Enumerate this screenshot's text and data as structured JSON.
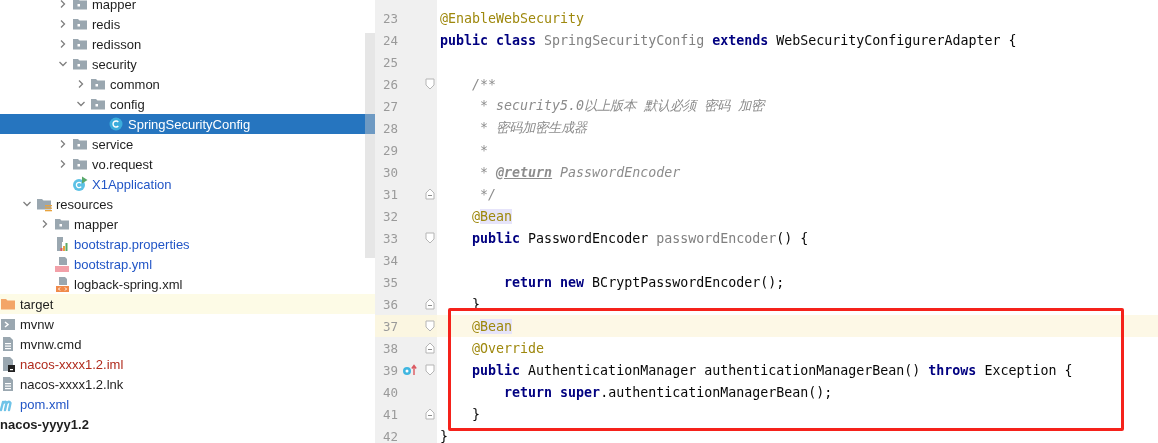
{
  "project_tree": {
    "items": [
      {
        "children": [
          {
            "children": [
              {
                "children": [
                  {
                    "label": "mapper",
                    "kind": "folder",
                    "expanded": false,
                    "selected": false,
                    "highlighted": false
                  },
                  {
                    "label": "redis",
                    "kind": "folder",
                    "expanded": false,
                    "selected": false,
                    "highlighted": false
                  },
                  {
                    "label": "redisson",
                    "kind": "folder",
                    "expanded": false,
                    "selected": false,
                    "highlighted": false
                  },
                  {
                    "label": "security",
                    "kind": "folder",
                    "expanded": true,
                    "selected": false,
                    "highlighted": false,
                    "children": [
                      {
                        "label": "common",
                        "kind": "folder",
                        "expanded": false,
                        "selected": false,
                        "highlighted": false
                      },
                      {
                        "label": "config",
                        "kind": "folder",
                        "expanded": true,
                        "selected": false,
                        "highlighted": false,
                        "children": [
                          {
                            "label": "SpringSecurityConfig",
                            "kind": "class",
                            "selected": true,
                            "highlighted": false
                          }
                        ]
                      }
                    ]
                  },
                  {
                    "label": "service",
                    "kind": "folder",
                    "expanded": false,
                    "selected": false,
                    "highlighted": false
                  },
                  {
                    "label": "vo.request",
                    "kind": "folder",
                    "expanded": false,
                    "selected": false,
                    "highlighted": false
                  },
                  {
                    "label": "X1Application",
                    "kind": "main-class",
                    "selected": false,
                    "highlighted": false,
                    "color": "#2155c6"
                  }
                ]
              }
            ]
          },
          {
            "label": "resources",
            "kind": "resources-folder",
            "expanded": true,
            "selected": false,
            "highlighted": false,
            "children": [
              {
                "label": "mapper",
                "kind": "folder",
                "expanded": false,
                "selected": false,
                "highlighted": false
              },
              {
                "label": "bootstrap.properties",
                "kind": "properties",
                "selected": false,
                "highlighted": false,
                "color": "#2155c6"
              },
              {
                "label": "bootstrap.yml",
                "kind": "yml",
                "selected": false,
                "highlighted": false,
                "color": "#2155c6"
              },
              {
                "label": "logback-spring.xml",
                "kind": "xml",
                "selected": false,
                "highlighted": false
              }
            ]
          }
        ]
      },
      {
        "label": "target",
        "kind": "excluded-folder",
        "selected": false,
        "highlighted": true
      },
      {
        "label": "mvnw",
        "kind": "script",
        "selected": false,
        "highlighted": false
      },
      {
        "label": "mvnw.cmd",
        "kind": "text-file",
        "selected": false,
        "highlighted": false
      },
      {
        "label": "nacos-xxxx1.2.iml",
        "kind": "iml",
        "selected": false,
        "highlighted": false,
        "color": "#b02a1c"
      },
      {
        "label": "nacos-xxxx1.2.lnk",
        "kind": "text-file",
        "selected": false,
        "highlighted": false
      },
      {
        "label": "pom.xml",
        "kind": "maven",
        "selected": false,
        "highlighted": false,
        "color": "#2155c6"
      },
      {
        "label": "nacos-yyyy1.2",
        "kind": "module",
        "selected": false,
        "highlighted": false
      }
    ]
  },
  "editor": {
    "lines": [
      {
        "number": "23",
        "current": false,
        "boxed": false,
        "fold_start": false,
        "fold_end": false,
        "overrides": false,
        "tokens": [
          {
            "kind": "annotation",
            "text": "@EnableWebSecurity"
          }
        ]
      },
      {
        "number": "24",
        "current": false,
        "boxed": false,
        "fold_start": false,
        "fold_end": false,
        "overrides": false,
        "tokens": [
          {
            "kind": "keyword",
            "text": "public"
          },
          {
            "kind": "keyword",
            "text": " class"
          },
          {
            "kind": "unused",
            "text": " SpringSecurityConfig"
          },
          {
            "kind": "keyword",
            "text": " extends"
          },
          {
            "kind": "plain",
            "text": " WebSecurityConfigurerAdapter {"
          }
        ]
      },
      {
        "number": "25",
        "current": false,
        "boxed": false,
        "fold_start": false,
        "fold_end": false,
        "overrides": false
      },
      {
        "number": "26",
        "current": false,
        "boxed": false,
        "fold_start": true,
        "fold_end": false,
        "overrides": false,
        "tokens": [
          {
            "kind": "comment",
            "text": "    /**"
          }
        ]
      },
      {
        "number": "27",
        "current": false,
        "boxed": false,
        "fold_start": false,
        "fold_end": false,
        "overrides": false,
        "tokens": [
          {
            "kind": "comment",
            "text": "     * security5.0以上版本 默认必须 密码 加密"
          }
        ]
      },
      {
        "number": "28",
        "current": false,
        "boxed": false,
        "fold_start": false,
        "fold_end": false,
        "overrides": false,
        "tokens": [
          {
            "kind": "comment",
            "text": "     * 密码加密生成器"
          }
        ]
      },
      {
        "number": "29",
        "current": false,
        "boxed": false,
        "fold_start": false,
        "fold_end": false,
        "overrides": false,
        "tokens": [
          {
            "kind": "comment",
            "text": "     *"
          }
        ]
      },
      {
        "number": "30",
        "current": false,
        "boxed": false,
        "fold_start": false,
        "fold_end": false,
        "overrides": false,
        "tokens": [
          {
            "kind": "comment",
            "text": "     * "
          },
          {
            "kind": "doc-tag",
            "text": "@return"
          },
          {
            "kind": "comment",
            "text": " PasswordEncoder"
          }
        ]
      },
      {
        "number": "31",
        "current": false,
        "boxed": false,
        "fold_start": false,
        "fold_end": true,
        "overrides": false,
        "tokens": [
          {
            "kind": "comment",
            "text": "     */"
          }
        ]
      },
      {
        "number": "32",
        "current": false,
        "boxed": false,
        "fold_start": false,
        "fold_end": false,
        "overrides": false,
        "tokens": [
          {
            "kind": "annotation",
            "text": "    @"
          },
          {
            "kind": "annotation-match",
            "text": "Bean"
          }
        ]
      },
      {
        "number": "33",
        "current": false,
        "boxed": false,
        "fold_start": true,
        "fold_end": false,
        "overrides": false,
        "tokens": [
          {
            "kind": "keyword",
            "text": "    public"
          },
          {
            "kind": "plain",
            "text": " PasswordEncoder "
          },
          {
            "kind": "unused",
            "text": "passwordEncoder"
          },
          {
            "kind": "plain",
            "text": "() {"
          }
        ]
      },
      {
        "number": "34",
        "current": false,
        "boxed": false,
        "fold_start": false,
        "fold_end": false,
        "overrides": false
      },
      {
        "number": "35",
        "current": false,
        "boxed": false,
        "fold_start": false,
        "fold_end": false,
        "overrides": false,
        "tokens": [
          {
            "kind": "keyword",
            "text": "        return"
          },
          {
            "kind": "keyword",
            "text": " new"
          },
          {
            "kind": "plain",
            "text": " BCryptPasswordEncoder();"
          }
        ]
      },
      {
        "number": "36",
        "current": false,
        "boxed": false,
        "fold_start": false,
        "fold_end": true,
        "overrides": false,
        "tokens": [
          {
            "kind": "plain",
            "text": "    }"
          }
        ]
      },
      {
        "number": "37",
        "current": true,
        "boxed": true,
        "fold_start": true,
        "fold_end": false,
        "overrides": false,
        "tokens": [
          {
            "kind": "annotation",
            "text": "    @"
          },
          {
            "kind": "annotation-match",
            "text": "Bean"
          }
        ]
      },
      {
        "number": "38",
        "current": false,
        "boxed": true,
        "fold_start": false,
        "fold_end": true,
        "overrides": false,
        "tokens": [
          {
            "kind": "annotation",
            "text": "    @Override"
          }
        ]
      },
      {
        "number": "39",
        "current": false,
        "boxed": true,
        "fold_start": true,
        "fold_end": false,
        "overrides": true,
        "tokens": [
          {
            "kind": "keyword",
            "text": "    public"
          },
          {
            "kind": "plain",
            "text": " AuthenticationManager authenticationManagerBean() "
          },
          {
            "kind": "keyword",
            "text": "throws"
          },
          {
            "kind": "plain",
            "text": " Exception {"
          }
        ]
      },
      {
        "number": "40",
        "current": false,
        "boxed": true,
        "fold_start": false,
        "fold_end": false,
        "overrides": false,
        "tokens": [
          {
            "kind": "keyword",
            "text": "        return"
          },
          {
            "kind": "keyword",
            "text": " super"
          },
          {
            "kind": "plain",
            "text": ".authenticationManagerBean();"
          }
        ]
      },
      {
        "number": "41",
        "current": false,
        "boxed": true,
        "fold_start": false,
        "fold_end": true,
        "overrides": false,
        "tokens": [
          {
            "kind": "plain",
            "text": "    }"
          }
        ]
      },
      {
        "number": "42",
        "current": false,
        "boxed": false,
        "fold_start": false,
        "fold_end": false,
        "overrides": false,
        "tokens": [
          {
            "kind": "plain",
            "text": "}"
          }
        ]
      }
    ]
  }
}
